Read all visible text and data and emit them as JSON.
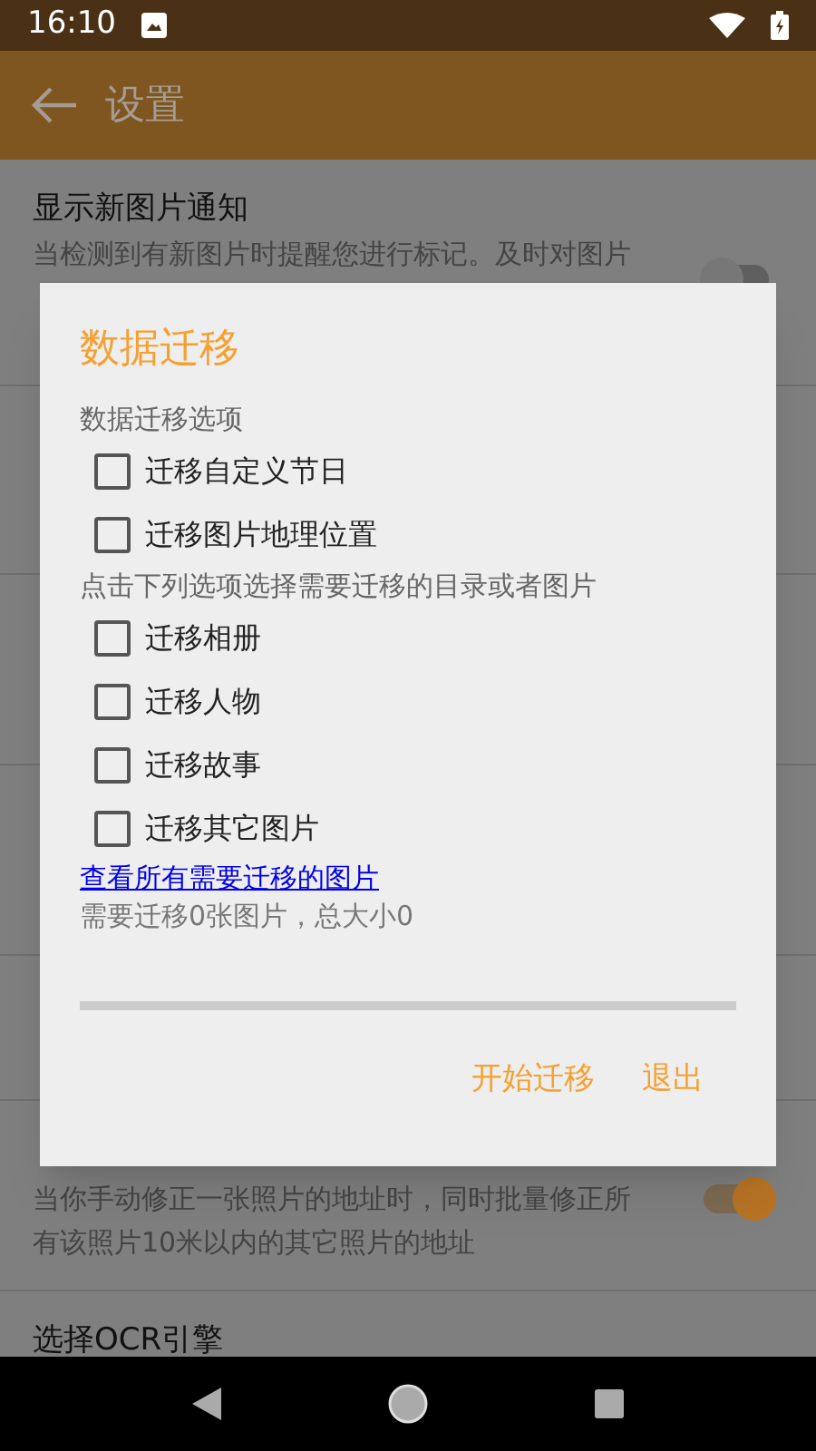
{
  "status_bar": {
    "time": "16:10"
  },
  "app_bar": {
    "title": "设置"
  },
  "settings": [
    {
      "title": "显示新图片通知",
      "description": "当检测到有新图片时提醒您进行标记。及时对图片",
      "on": false
    },
    {
      "description": "当你手动修正一张照片的地址时，同时批量修正所有该照片10米以内的其它照片的地址",
      "on": true
    },
    {
      "title": "选择OCR引擎"
    }
  ],
  "dialog": {
    "title": "数据迁移",
    "sections": [
      {
        "label": "数据迁移选项",
        "options": [
          {
            "label": "迁移自定义节日",
            "checked": false
          },
          {
            "label": "迁移图片地理位置",
            "checked": false
          }
        ]
      },
      {
        "label": "点击下列选项选择需要迁移的目录或者图片",
        "options": [
          {
            "label": "迁移相册",
            "checked": false
          },
          {
            "label": "迁移人物",
            "checked": false
          },
          {
            "label": "迁移故事",
            "checked": false
          },
          {
            "label": "迁移其它图片",
            "checked": false
          }
        ]
      }
    ],
    "link": "查看所有需要迁移的图片",
    "summary": "需要迁移0张图片，总大小0",
    "progress": {
      "level": 0
    },
    "buttons": [
      "开始迁移",
      "退出"
    ]
  }
}
